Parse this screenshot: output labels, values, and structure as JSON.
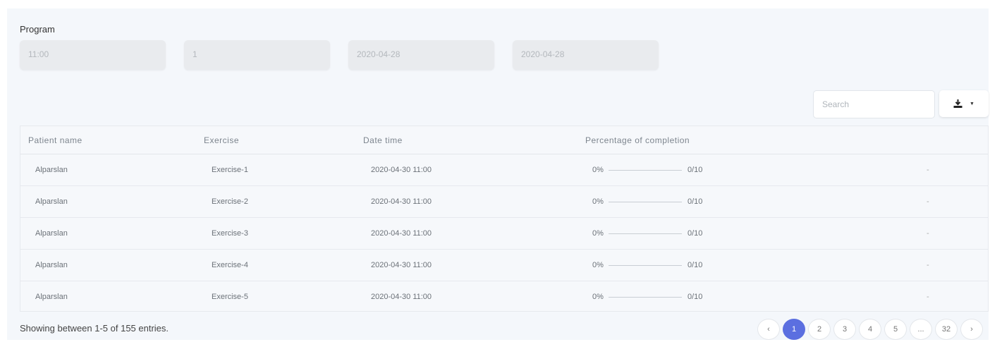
{
  "program": {
    "label": "Program",
    "fields": [
      "11:00",
      "1",
      "2020-04-28",
      "2020-04-28"
    ]
  },
  "toolbar": {
    "search_placeholder": "Search",
    "export_icon": "download-icon"
  },
  "table": {
    "headers": [
      "Patient name",
      "Exercise",
      "Date time",
      "Percentage of completion"
    ],
    "rows": [
      {
        "patient": "Alparslan",
        "exercise": "Exercise-1",
        "datetime": "2020-04-30 11:00",
        "percent": "0%",
        "progress": "0/10",
        "progress_fraction": 0,
        "extra": "-"
      },
      {
        "patient": "Alparslan",
        "exercise": "Exercise-2",
        "datetime": "2020-04-30 11:00",
        "percent": "0%",
        "progress": "0/10",
        "progress_fraction": 0,
        "extra": "-"
      },
      {
        "patient": "Alparslan",
        "exercise": "Exercise-3",
        "datetime": "2020-04-30 11:00",
        "percent": "0%",
        "progress": "0/10",
        "progress_fraction": 0,
        "extra": "-"
      },
      {
        "patient": "Alparslan",
        "exercise": "Exercise-4",
        "datetime": "2020-04-30 11:00",
        "percent": "0%",
        "progress": "0/10",
        "progress_fraction": 0,
        "extra": "-"
      },
      {
        "patient": "Alparslan",
        "exercise": "Exercise-5",
        "datetime": "2020-04-30 11:00",
        "percent": "0%",
        "progress": "0/10",
        "progress_fraction": 0,
        "extra": "-"
      }
    ]
  },
  "footer": {
    "showing": "Showing between 1-5 of 155 entries."
  },
  "pagination": {
    "prev": "‹",
    "pages": [
      "1",
      "2",
      "3",
      "4",
      "5",
      "...",
      "32"
    ],
    "next": "›",
    "active": "1"
  },
  "colors": {
    "accent": "#5b6fe0",
    "panel_bg": "#f4f7fb",
    "field_bg": "#e9ebee"
  }
}
